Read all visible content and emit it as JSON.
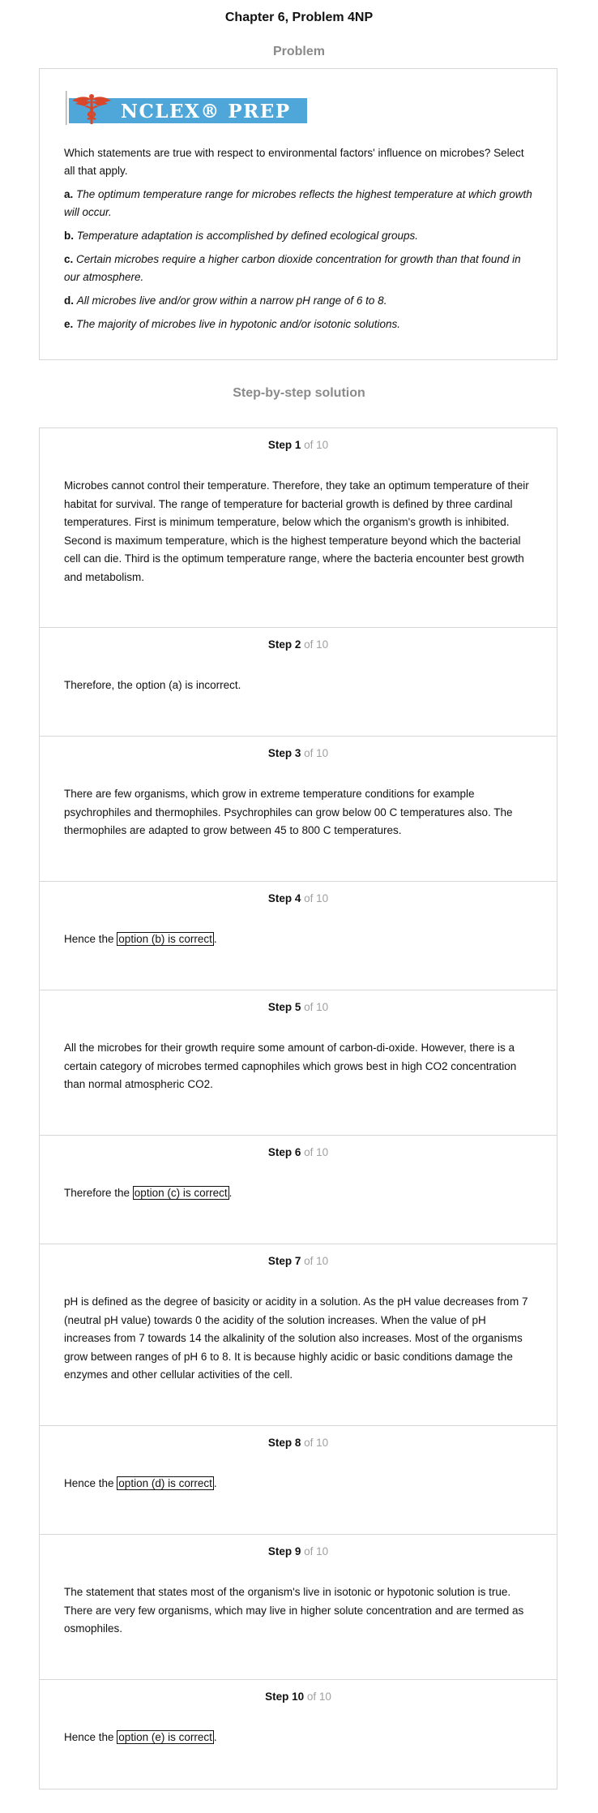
{
  "page": {
    "title": "Chapter 6, Problem 4NP",
    "problem_heading": "Problem",
    "solution_heading": "Step-by-step solution"
  },
  "logo": {
    "text": "NCLEX® PREP",
    "bar_color": "#4fa7d9",
    "caduceus_color": "#d9472b",
    "icon": "caduceus-icon"
  },
  "problem": {
    "question": "Which statements are true with respect to environmental factors' influence on microbes? Select all that apply.",
    "options": [
      {
        "letter": "a.",
        "text": "The optimum temperature range for microbes reflects the highest temperature at which growth will occur."
      },
      {
        "letter": "b.",
        "text": "Temperature adaptation is accomplished by defined ecological groups."
      },
      {
        "letter": "c.",
        "text": "Certain microbes require a higher carbon dioxide concentration for growth than that found in our atmosphere."
      },
      {
        "letter": "d.",
        "text": "All microbes live and/or grow within a narrow pH range of 6 to 8."
      },
      {
        "letter": "e.",
        "text": "The majority of microbes live in hypotonic and/or isotonic solutions."
      }
    ]
  },
  "steps": [
    {
      "label": "Step",
      "num": "1",
      "of": "of 10",
      "text": "Microbes cannot control their temperature. Therefore, they take an optimum temperature of their habitat for survival. The range of temperature for bacterial growth is defined by three cardinal temperatures. First is minimum temperature, below which the organism's growth is inhibited. Second is maximum temperature, which is the highest temperature beyond which the bacterial cell can die. Third is the optimum temperature range, where the bacteria encounter best growth and metabolism."
    },
    {
      "label": "Step",
      "num": "2",
      "of": "of 10",
      "text": "Therefore, the option (a) is incorrect."
    },
    {
      "label": "Step",
      "num": "3",
      "of": "of 10",
      "text": "There are few organisms, which grow in extreme temperature conditions for example psychrophiles and thermophiles. Psychrophiles can grow below 00 C temperatures also. The thermophiles are adapted to grow between 45 to 800 C temperatures."
    },
    {
      "label": "Step",
      "num": "4",
      "of": "of 10",
      "prefix": "Hence the ",
      "boxed": "option (b) is correct",
      "suffix": "."
    },
    {
      "label": "Step",
      "num": "5",
      "of": "of 10",
      "text": "All the microbes for their growth require some amount of carbon-di-oxide. However, there is a certain category of microbes termed capnophiles which grows best in high CO2 concentration than normal atmospheric CO2."
    },
    {
      "label": "Step",
      "num": "6",
      "of": "of 10",
      "prefix": "Therefore the ",
      "boxed": "option (c) is correct",
      "suffix": "."
    },
    {
      "label": "Step",
      "num": "7",
      "of": "of 10",
      "text": "pH is defined as the degree of basicity or acidity in a solution. As the pH value decreases from 7 (neutral pH value) towards 0 the acidity of the solution increases. When the value of pH increases from 7 towards 14 the alkalinity of the solution also increases. Most of the organisms grow between ranges of pH 6 to 8. It is because highly acidic or basic conditions damage the enzymes and other cellular activities of the cell."
    },
    {
      "label": "Step",
      "num": "8",
      "of": "of 10",
      "prefix": "Hence the ",
      "boxed": "option (d) is correct",
      "suffix": "."
    },
    {
      "label": "Step",
      "num": "9",
      "of": "of 10",
      "text": "The statement that states most of the organism's live in isotonic or hypotonic solution is true. There are very few organisms, which may live in higher solute concentration and are termed as osmophiles."
    },
    {
      "label": "Step",
      "num": "10",
      "of": "of 10",
      "prefix": "Hence the ",
      "boxed": "option (e) is correct",
      "suffix": "."
    }
  ]
}
